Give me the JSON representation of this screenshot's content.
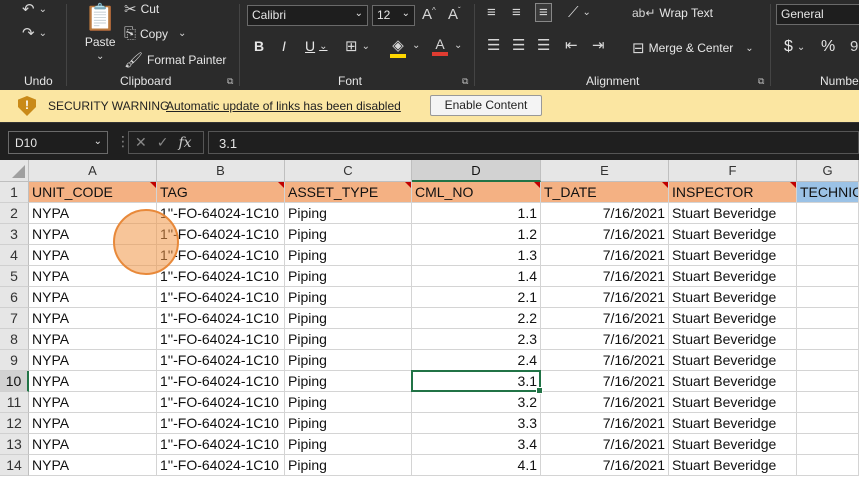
{
  "ribbon": {
    "undo_label": "Undo",
    "clipboard": {
      "group_label": "Clipboard",
      "paste_label": "Paste",
      "cut_label": "Cut",
      "copy_label": "Copy",
      "format_painter_label": "Format Painter"
    },
    "font": {
      "group_label": "Font",
      "family": "Calibri",
      "size": "12",
      "bold": "B",
      "italic": "I",
      "underline": "U",
      "fill_color": "#ffd700",
      "font_color": "#e03c31"
    },
    "alignment": {
      "group_label": "Alignment",
      "wrap_text_label": "Wrap Text",
      "merge_center_label": "Merge & Center"
    },
    "number": {
      "group_label": "Numbe",
      "format": "General",
      "currency": "$",
      "percent": "%"
    }
  },
  "security_bar": {
    "title": "SECURITY WARNING",
    "message": "Automatic update of links has been disabled",
    "button_label": "Enable Content"
  },
  "formula_bar": {
    "name_box": "D10",
    "value": "3.1"
  },
  "sheet": {
    "columns": [
      "A",
      "B",
      "C",
      "D",
      "E",
      "F",
      "G"
    ],
    "selected_column": "D",
    "selected_row": "10",
    "header_row": [
      "UNIT_CODE",
      "TAG",
      "ASSET_TYPE",
      "CML_NO",
      "T_DATE",
      "INSPECTOR",
      "TECHNIC"
    ],
    "rows": [
      {
        "n": "1"
      },
      {
        "n": "2",
        "cells": [
          "NYPA",
          "1''-FO-64024-1C10",
          "Piping",
          "1.1",
          "7/16/2021",
          "Stuart Beveridge"
        ]
      },
      {
        "n": "3",
        "cells": [
          "NYPA",
          "1''-FO-64024-1C10",
          "Piping",
          "1.2",
          "7/16/2021",
          "Stuart Beveridge"
        ]
      },
      {
        "n": "4",
        "cells": [
          "NYPA",
          "1''-FO-64024-1C10",
          "Piping",
          "1.3",
          "7/16/2021",
          "Stuart Beveridge"
        ]
      },
      {
        "n": "5",
        "cells": [
          "NYPA",
          "1''-FO-64024-1C10",
          "Piping",
          "1.4",
          "7/16/2021",
          "Stuart Beveridge"
        ]
      },
      {
        "n": "6",
        "cells": [
          "NYPA",
          "1''-FO-64024-1C10",
          "Piping",
          "2.1",
          "7/16/2021",
          "Stuart Beveridge"
        ]
      },
      {
        "n": "7",
        "cells": [
          "NYPA",
          "1''-FO-64024-1C10",
          "Piping",
          "2.2",
          "7/16/2021",
          "Stuart Beveridge"
        ]
      },
      {
        "n": "8",
        "cells": [
          "NYPA",
          "1''-FO-64024-1C10",
          "Piping",
          "2.3",
          "7/16/2021",
          "Stuart Beveridge"
        ]
      },
      {
        "n": "9",
        "cells": [
          "NYPA",
          "1''-FO-64024-1C10",
          "Piping",
          "2.4",
          "7/16/2021",
          "Stuart Beveridge"
        ]
      },
      {
        "n": "10",
        "cells": [
          "NYPA",
          "1''-FO-64024-1C10",
          "Piping",
          "3.1",
          "7/16/2021",
          "Stuart Beveridge"
        ]
      },
      {
        "n": "11",
        "cells": [
          "NYPA",
          "1''-FO-64024-1C10",
          "Piping",
          "3.2",
          "7/16/2021",
          "Stuart Beveridge"
        ]
      },
      {
        "n": "12",
        "cells": [
          "NYPA",
          "1''-FO-64024-1C10",
          "Piping",
          "3.3",
          "7/16/2021",
          "Stuart Beveridge"
        ]
      },
      {
        "n": "13",
        "cells": [
          "NYPA",
          "1''-FO-64024-1C10",
          "Piping",
          "3.4",
          "7/16/2021",
          "Stuart Beveridge"
        ]
      },
      {
        "n": "14",
        "cells": [
          "NYPA",
          "1''-FO-64024-1C10",
          "Piping",
          "4.1",
          "7/16/2021",
          "Stuart Beveridge"
        ]
      }
    ]
  }
}
